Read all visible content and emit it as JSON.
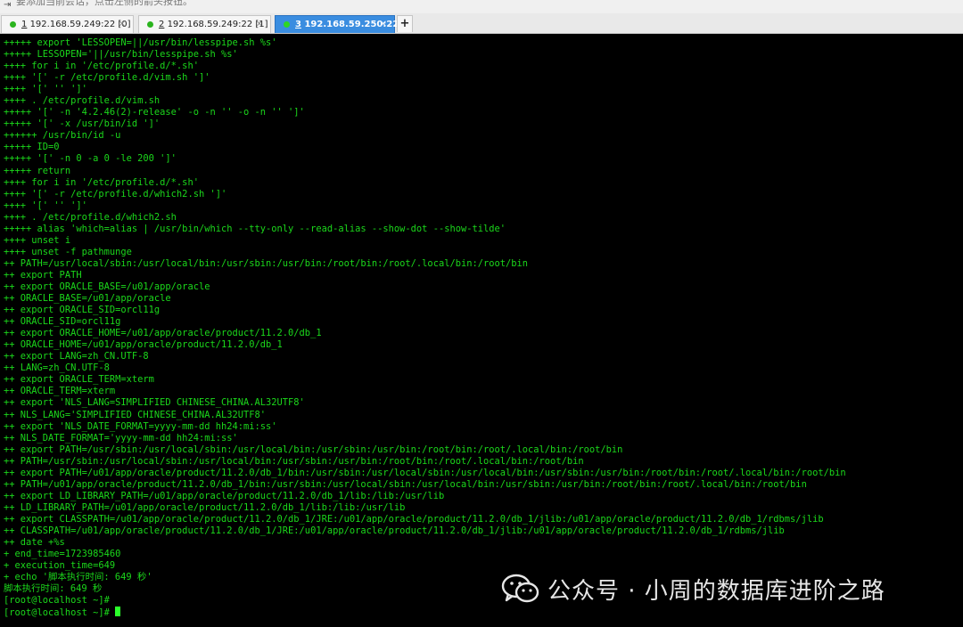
{
  "hint_bar": {
    "text": "要添加当前会话，点击左侧的箭头按钮。"
  },
  "tabs": [
    {
      "number": "1",
      "label": "192.168.59.249:22 [0]",
      "active": false
    },
    {
      "number": "2",
      "label": "192.168.59.249:22 [1]",
      "active": false
    },
    {
      "number": "3",
      "label": "192.168.59.250:22",
      "active": true
    }
  ],
  "new_tab_label": "+",
  "terminal": {
    "lines": [
      "+++++ export 'LESSOPEN=||/usr/bin/lesspipe.sh %s'",
      "+++++ LESSOPEN='||/usr/bin/lesspipe.sh %s'",
      "++++ for i in '/etc/profile.d/*.sh'",
      "++++ '[' -r /etc/profile.d/vim.sh ']'",
      "++++ '[' '' ']'",
      "++++ . /etc/profile.d/vim.sh",
      "+++++ '[' -n '4.2.46(2)-release' -o -n '' -o -n '' ']'",
      "+++++ '[' -x /usr/bin/id ']'",
      "++++++ /usr/bin/id -u",
      "+++++ ID=0",
      "+++++ '[' -n 0 -a 0 -le 200 ']'",
      "+++++ return",
      "++++ for i in '/etc/profile.d/*.sh'",
      "++++ '[' -r /etc/profile.d/which2.sh ']'",
      "++++ '[' '' ']'",
      "++++ . /etc/profile.d/which2.sh",
      "+++++ alias 'which=alias | /usr/bin/which --tty-only --read-alias --show-dot --show-tilde'",
      "++++ unset i",
      "++++ unset -f pathmunge",
      "++ PATH=/usr/local/sbin:/usr/local/bin:/usr/sbin:/usr/bin:/root/bin:/root/.local/bin:/root/bin",
      "++ export PATH",
      "++ export ORACLE_BASE=/u01/app/oracle",
      "++ ORACLE_BASE=/u01/app/oracle",
      "++ export ORACLE_SID=orcl11g",
      "++ ORACLE_SID=orcl11g",
      "++ export ORACLE_HOME=/u01/app/oracle/product/11.2.0/db_1",
      "++ ORACLE_HOME=/u01/app/oracle/product/11.2.0/db_1",
      "++ export LANG=zh_CN.UTF-8",
      "++ LANG=zh_CN.UTF-8",
      "++ export ORACLE_TERM=xterm",
      "++ ORACLE_TERM=xterm",
      "++ export 'NLS_LANG=SIMPLIFIED CHINESE_CHINA.AL32UTF8'",
      "++ NLS_LANG='SIMPLIFIED CHINESE_CHINA.AL32UTF8'",
      "++ export 'NLS_DATE_FORMAT=yyyy-mm-dd hh24:mi:ss'",
      "++ NLS_DATE_FORMAT='yyyy-mm-dd hh24:mi:ss'",
      "++ export PATH=/usr/sbin:/usr/local/sbin:/usr/local/bin:/usr/sbin:/usr/bin:/root/bin:/root/.local/bin:/root/bin",
      "++ PATH=/usr/sbin:/usr/local/sbin:/usr/local/bin:/usr/sbin:/usr/bin:/root/bin:/root/.local/bin:/root/bin",
      "++ export PATH=/u01/app/oracle/product/11.2.0/db_1/bin:/usr/sbin:/usr/local/sbin:/usr/local/bin:/usr/sbin:/usr/bin:/root/bin:/root/.local/bin:/root/bin",
      "++ PATH=/u01/app/oracle/product/11.2.0/db_1/bin:/usr/sbin:/usr/local/sbin:/usr/local/bin:/usr/sbin:/usr/bin:/root/bin:/root/.local/bin:/root/bin",
      "++ export LD_LIBRARY_PATH=/u01/app/oracle/product/11.2.0/db_1/lib:/lib:/usr/lib",
      "++ LD_LIBRARY_PATH=/u01/app/oracle/product/11.2.0/db_1/lib:/lib:/usr/lib",
      "++ export CLASSPATH=/u01/app/oracle/product/11.2.0/db_1/JRE:/u01/app/oracle/product/11.2.0/db_1/jlib:/u01/app/oracle/product/11.2.0/db_1/rdbms/jlib",
      "++ CLASSPATH=/u01/app/oracle/product/11.2.0/db_1/JRE:/u01/app/oracle/product/11.2.0/db_1/jlib:/u01/app/oracle/product/11.2.0/db_1/rdbms/jlib",
      "++ date +%s",
      "+ end_time=1723985460",
      "+ execution_time=649",
      "+ echo '脚本执行时间: 649 秒'",
      "脚本执行时间: 649 秒",
      "[root@localhost ~]#",
      "[root@localhost ~]# "
    ]
  },
  "watermark": {
    "text": "公众号 · 小周的数据库进阶之路",
    "icon": "wechat-icon"
  }
}
